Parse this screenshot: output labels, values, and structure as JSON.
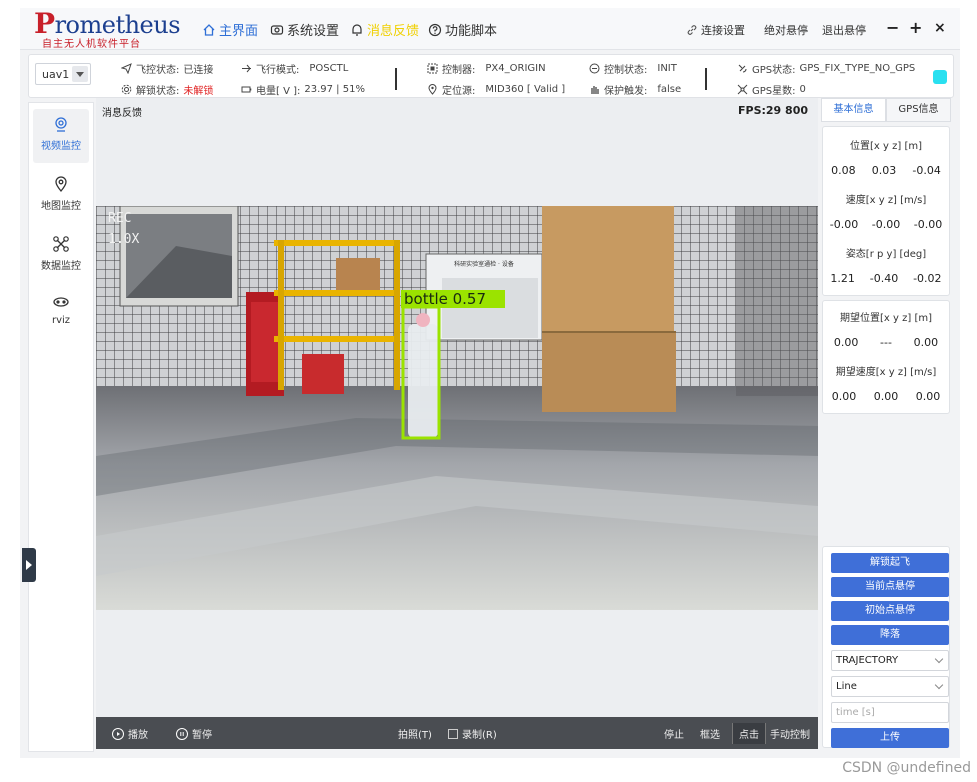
{
  "app": {
    "logo_word": "Prometheus",
    "logo_subtitle": "自主无人机软件平台"
  },
  "nav": [
    {
      "label": "主界面",
      "icon": "home-icon",
      "active": true
    },
    {
      "label": "系统设置",
      "icon": "settings-icon"
    },
    {
      "label": "消息反馈",
      "icon": "bell-icon",
      "highlight": true
    },
    {
      "label": "功能脚本",
      "icon": "question-icon"
    }
  ],
  "topright": {
    "connect": "连接设置",
    "abs_hover": "绝对悬停",
    "exit_hover": "退出悬停"
  },
  "status": {
    "uav": "uav1",
    "flight_ctrl_label": "飞控状态:",
    "flight_ctrl_value": "已连接",
    "unlock_label": "解锁状态:",
    "unlock_value": "未解锁",
    "mode_label": "飞行模式:",
    "mode_value": "POSCTL",
    "battery_label": "电量[ V ]:",
    "battery_value": "23.97 | 51%",
    "controller_label": "控制器:",
    "controller_value": "PX4_ORIGIN",
    "locator_label": "定位源:",
    "locator_value": "MID360 [ Valid ]",
    "ctrl_state_label": "控制状态:",
    "ctrl_state_value": "INIT",
    "protect_label": "保护触发:",
    "protect_value": "false",
    "gps_state_label": "GPS状态:",
    "gps_state_value": "GPS_FIX_TYPE_NO_GPS",
    "gps_sats_label": "GPS星数:",
    "gps_sats_value": "0",
    "indicator_color": "#29e0f0"
  },
  "sidebar": [
    {
      "label": "视频监控",
      "icon": "camera-icon",
      "active": true
    },
    {
      "label": "地图监控",
      "icon": "map-pin-icon"
    },
    {
      "label": "数据监控",
      "icon": "drone-icon"
    },
    {
      "label": "rviz",
      "icon": "rviz-icon"
    }
  ],
  "video": {
    "header": "消息反馈",
    "fps": "FPS:29  800",
    "rec": "REC",
    "zoom": "1.0X",
    "detection_label": "bottle 0.57",
    "sign_text": "科研实验室通检 · 设备"
  },
  "controls": {
    "play": "播放",
    "pause": "暂停",
    "photo": "拍照(T)",
    "record": "录制(R)",
    "stop": "停止",
    "box_select": "框选",
    "click_select": "点击",
    "manual": "手动控制"
  },
  "right": {
    "tab_basic": "基本信息",
    "tab_gps": "GPS信息",
    "pos_title": "位置[x y z] [m]",
    "pos": [
      "0.08",
      "0.03",
      "-0.04"
    ],
    "vel_title": "速度[x y z] [m/s]",
    "vel": [
      "-0.00",
      "-0.00",
      "-0.00"
    ],
    "att_title": "姿态[r p y] [deg]",
    "att": [
      "1.21",
      "-0.40",
      "-0.02"
    ],
    "exp_pos_title": "期望位置[x y z] [m]",
    "exp_pos": [
      "0.00",
      "---",
      "0.00"
    ],
    "exp_vel_title": "期望速度[x y z] [m/s]",
    "exp_vel": [
      "0.00",
      "0.00",
      "0.00"
    ],
    "btn_takeoff": "解锁起飞",
    "btn_hover_current": "当前点悬停",
    "btn_hover_init": "初始点悬停",
    "btn_land": "降落",
    "select_traj": "TRAJECTORY",
    "select_shape": "Line",
    "time_placeholder": "time [s]",
    "btn_upload": "上传"
  },
  "watermark": "CSDN @undefined"
}
